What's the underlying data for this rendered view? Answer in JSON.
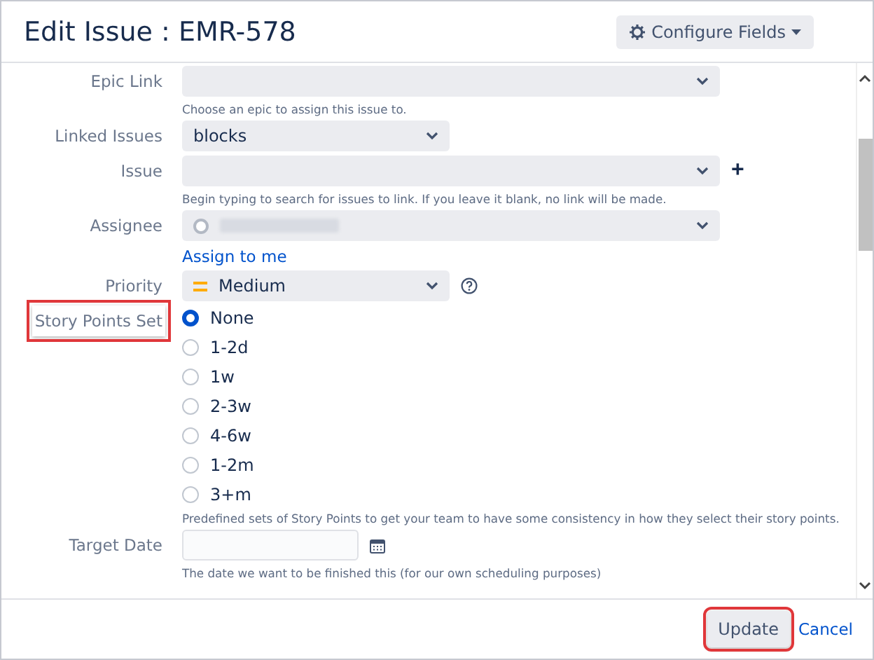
{
  "dialog": {
    "title": "Edit Issue : EMR-578",
    "configure_button": "Configure Fields"
  },
  "fields": [
    {
      "kind": "select",
      "label": "Epic Link",
      "wide": true,
      "hint": "Choose an epic to assign this issue to."
    },
    {
      "kind": "select",
      "label": "Linked Issues",
      "value": "blocks",
      "wide": false
    },
    {
      "kind": "select",
      "label": "Issue",
      "wide": true,
      "add": "+",
      "hint": "Begin typing to search for issues to link. If you leave it blank, no link will be made."
    },
    {
      "kind": "user",
      "label": "Assignee",
      "wide": true,
      "link": "Assign to me"
    },
    {
      "kind": "priority",
      "label": "Priority",
      "value": "Medium",
      "wide": false
    },
    {
      "kind": "radio",
      "label": "Story Points Set",
      "highlighted": true,
      "options": [
        {
          "label": "None",
          "selected": true
        },
        {
          "label": "1-2d",
          "selected": false
        },
        {
          "label": "1w",
          "selected": false
        },
        {
          "label": "2-3w",
          "selected": false
        },
        {
          "label": "4-6w",
          "selected": false
        },
        {
          "label": "1-2m",
          "selected": false
        },
        {
          "label": "3+m",
          "selected": false
        }
      ],
      "hint": "Predefined sets of Story Points to get your team to have some consistency in how they select their story points."
    },
    {
      "kind": "date",
      "label": "Target Date",
      "hint": "The date we want to be finished this (for our own scheduling purposes)"
    }
  ],
  "footer": {
    "update": {
      "label": "Update",
      "highlighted": true
    },
    "cancel": "Cancel"
  }
}
